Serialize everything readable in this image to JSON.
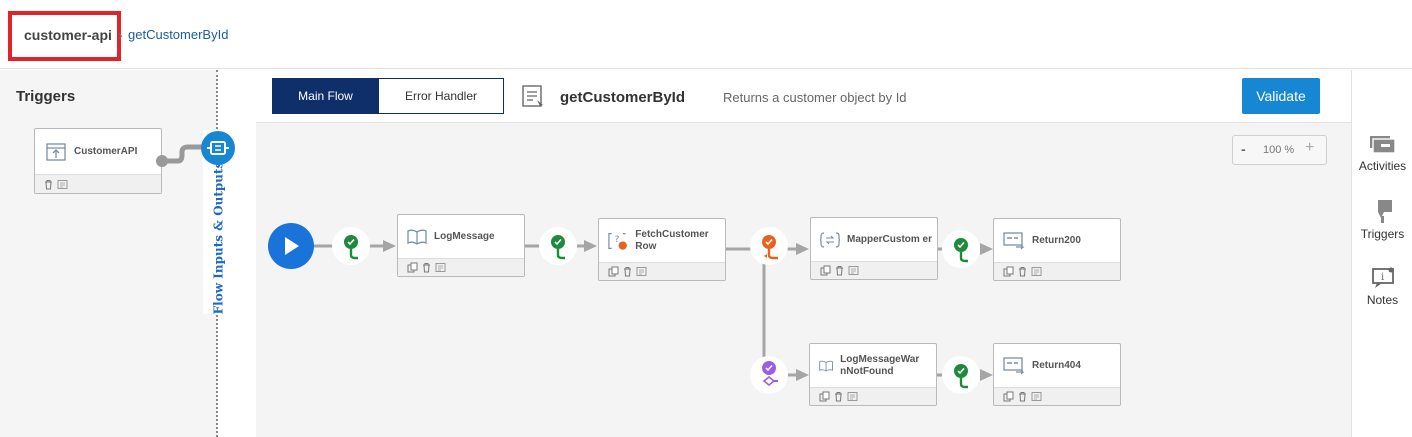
{
  "breadcrumb": {
    "app": "customer-api",
    "separator": "›",
    "flow": "getCustomerById"
  },
  "triggers_panel": {
    "title": "Triggers",
    "trigger": {
      "label": "CustomerAPI",
      "icon": "rest-trigger-icon"
    },
    "io_label": "Flow Inputs & Outputs"
  },
  "toolbar": {
    "tabs": [
      {
        "label": "Main Flow",
        "active": true
      },
      {
        "label": "Error Handler",
        "active": false
      }
    ],
    "flow_title": "getCustomerById",
    "flow_description": "Returns a customer object by Id",
    "validate_label": "Validate"
  },
  "zoom": {
    "minus": "-",
    "value": "100 %",
    "plus": "+"
  },
  "right_panel": [
    {
      "label": "Activities",
      "icon": "activities-icon"
    },
    {
      "label": "Triggers",
      "icon": "triggers-icon"
    },
    {
      "label": "Notes",
      "icon": "notes-icon"
    }
  ],
  "activities": [
    {
      "id": "log",
      "label": "LogMessage",
      "icon": "log-icon"
    },
    {
      "id": "fetch",
      "label": "FetchCustomer Row",
      "icon": "query-icon"
    },
    {
      "id": "mapper",
      "label": "MapperCustom er",
      "icon": "mapper-icon"
    },
    {
      "id": "ret200",
      "label": "Return200",
      "icon": "return-icon"
    },
    {
      "id": "logwarn",
      "label": "LogMessageWar nNotFound",
      "icon": "log-icon"
    },
    {
      "id": "ret404",
      "label": "Return404",
      "icon": "return-icon"
    }
  ],
  "colors": {
    "primary": "#0e2f6a",
    "accent": "#1787d4",
    "success": "#1e8a3b",
    "branch": "#e8621f",
    "otherwise": "#9b5de5",
    "highlight": "#e3232a"
  }
}
